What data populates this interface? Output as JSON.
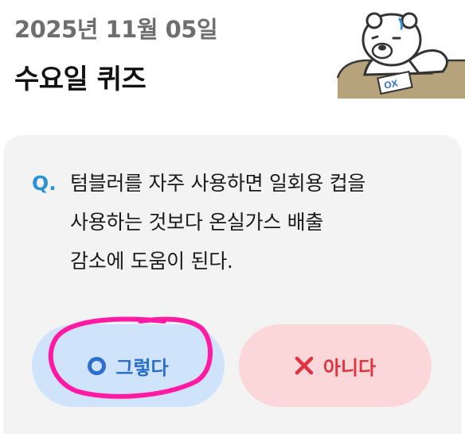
{
  "header": {
    "date": "2025년 11월 05일",
    "title": "수요일 퀴즈"
  },
  "quiz": {
    "q_mark": "Q.",
    "question_lines": [
      "텀블러를 자주 사용하면 일회용 컵을",
      "사용하는 것보다 온실가스 배출",
      "감소에 도움이 된다."
    ],
    "answers": {
      "yes_label": "그렇다",
      "no_label": "아니다"
    }
  },
  "mascot": {
    "card_text": "OX"
  },
  "colors": {
    "accent_blue": "#2c92d6",
    "yes_bg": "#cfe3fb",
    "yes_fg": "#2b6fcf",
    "no_bg": "#fcd7da",
    "no_fg": "#e0323f",
    "annotation": "#ff1aa3"
  },
  "icons": {
    "yes_icon": "circle-o-icon",
    "no_icon": "x-mark-icon"
  }
}
